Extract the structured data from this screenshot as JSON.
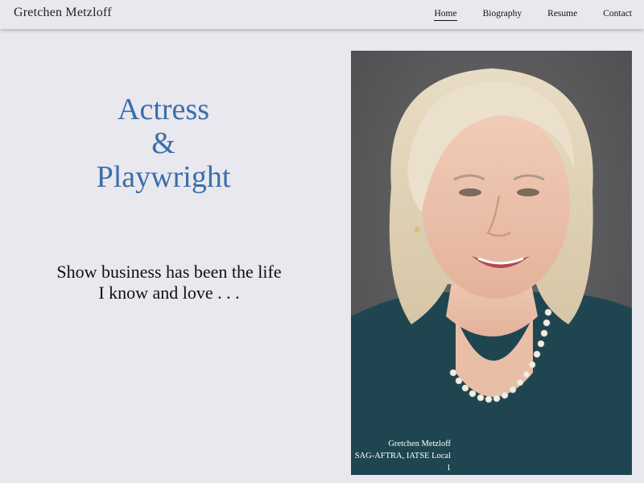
{
  "header": {
    "site_name": "Gretchen Metzloff",
    "nav": [
      {
        "label": "Home",
        "active": true
      },
      {
        "label": "Biography",
        "active": false
      },
      {
        "label": "Resume",
        "active": false
      },
      {
        "label": "Contact",
        "active": false
      }
    ]
  },
  "hero": {
    "title_line1": "Actress",
    "title_line2": "&",
    "title_line3": "Playwright",
    "tagline_line1": "Show business has been the life",
    "tagline_line2": "I know and love . . ."
  },
  "portrait": {
    "caption_name": "Gretchen Metzloff",
    "caption_union": "SAG-AFTRA, IATSE Local",
    "caption_local": "1"
  },
  "colors": {
    "background": "#e9e8ee",
    "accent": "#3a6eaa",
    "photo_backdrop": "#5a5a5c",
    "blouse": "#1f4650"
  }
}
